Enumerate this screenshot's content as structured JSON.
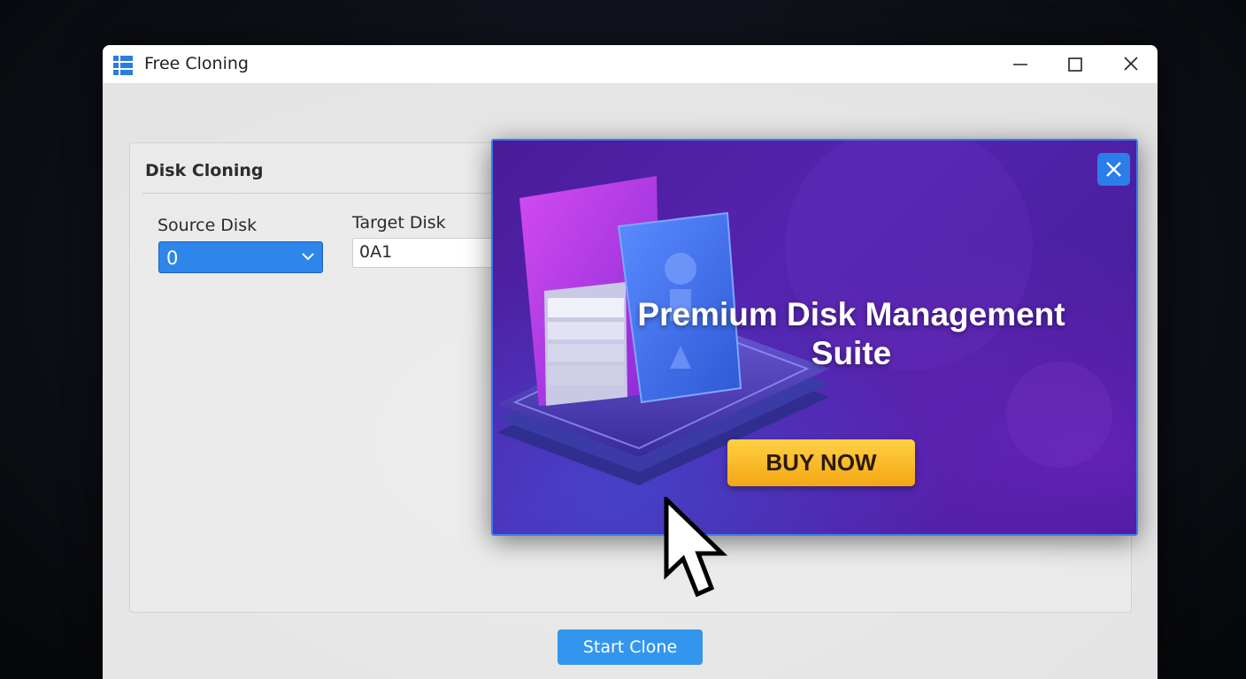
{
  "window": {
    "title": "Free Cloning",
    "icons": {
      "app": "windows-grid-icon",
      "minimize": "minimize-icon",
      "maximize": "maximize-icon",
      "close": "close-icon"
    }
  },
  "disk_cloning": {
    "title": "Disk Cloning",
    "source_label": "Source Disk",
    "source_value": "0",
    "target_label": "Target Disk",
    "target_value": "0A1",
    "start_label": "Start Clone"
  },
  "ad": {
    "title": "Premium Disk Management Suite",
    "buy_label": "BUY NOW",
    "close_icon": "close-icon",
    "colors": {
      "background": "#5524b0",
      "close": "#2b7ee8",
      "buy": "#f4a614"
    }
  },
  "colors": {
    "accent": "#3396ee",
    "select": "#2f86ea"
  }
}
